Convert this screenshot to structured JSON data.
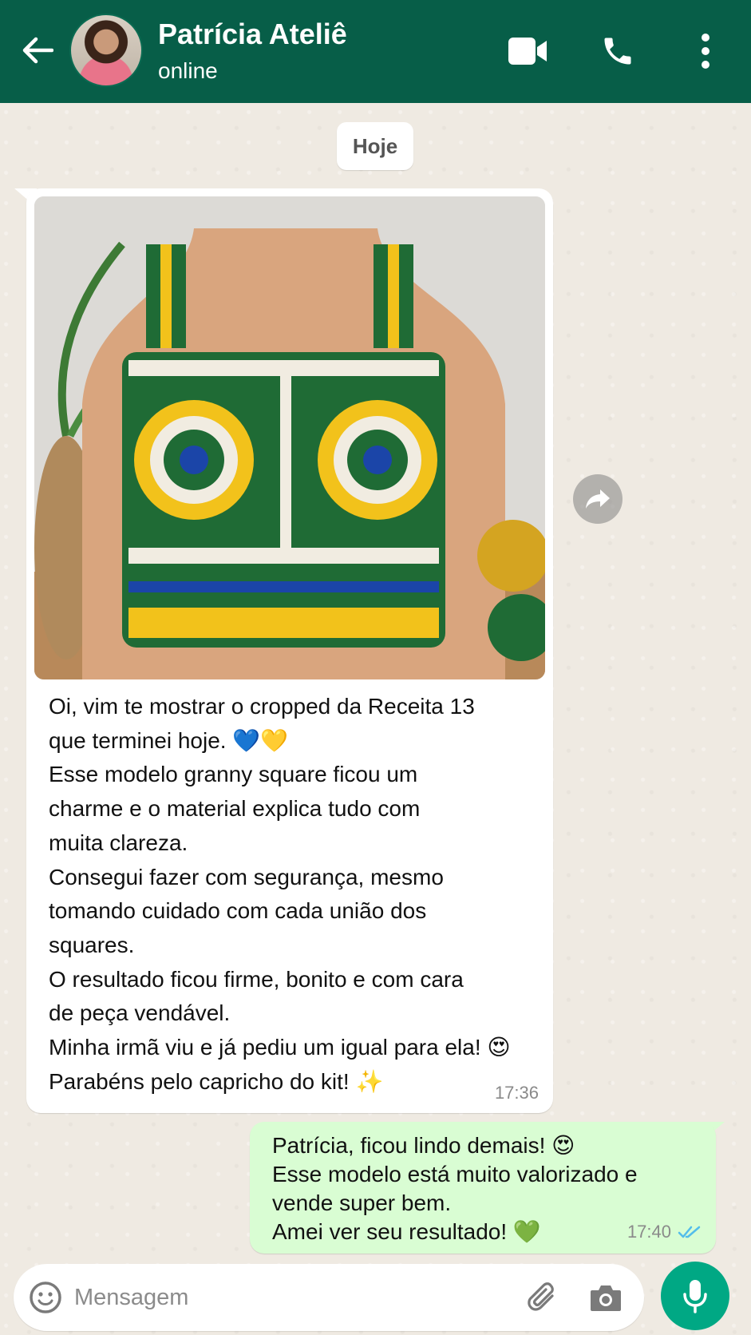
{
  "header": {
    "contact_name": "Patrícia Ateliê",
    "status": "online",
    "icons": [
      "arrow-back-icon",
      "avatar",
      "video-camera-icon",
      "phone-icon",
      "more-vertical-icon"
    ],
    "accent": "#075e48"
  },
  "date_chip": "Hoje",
  "incoming": {
    "photo_alt": "cropped granny square",
    "lines": [
      "Oi, vim te mostrar o cropped da Receita 13",
      "que terminei hoje. 💙💛",
      "Esse modelo granny square ficou um",
      "charme e o material explica tudo com",
      "muita clareza.",
      "Consegui fazer com segurança, mesmo",
      "tomando cuidado com cada união dos",
      "squares.",
      "O resultado ficou firme, bonito e com cara",
      "de peça vendável.",
      "Minha irmã viu e já pediu um igual para ela! 😍",
      "Parabéns pelo capricho do kit! ✨"
    ],
    "time": "17:36"
  },
  "outgoing": {
    "lines": [
      "Patrícia, ficou lindo demais! 😍",
      "Esse modelo está muito valorizado e",
      "vende super bem.",
      "Amei ver seu resultado! 💚"
    ],
    "time": "17:40",
    "status_icon": "double-check-icon",
    "bubble_color": "#d9fdd3"
  },
  "composer": {
    "placeholder": "Mensagem",
    "value": "",
    "mic_color": "#00a884"
  }
}
